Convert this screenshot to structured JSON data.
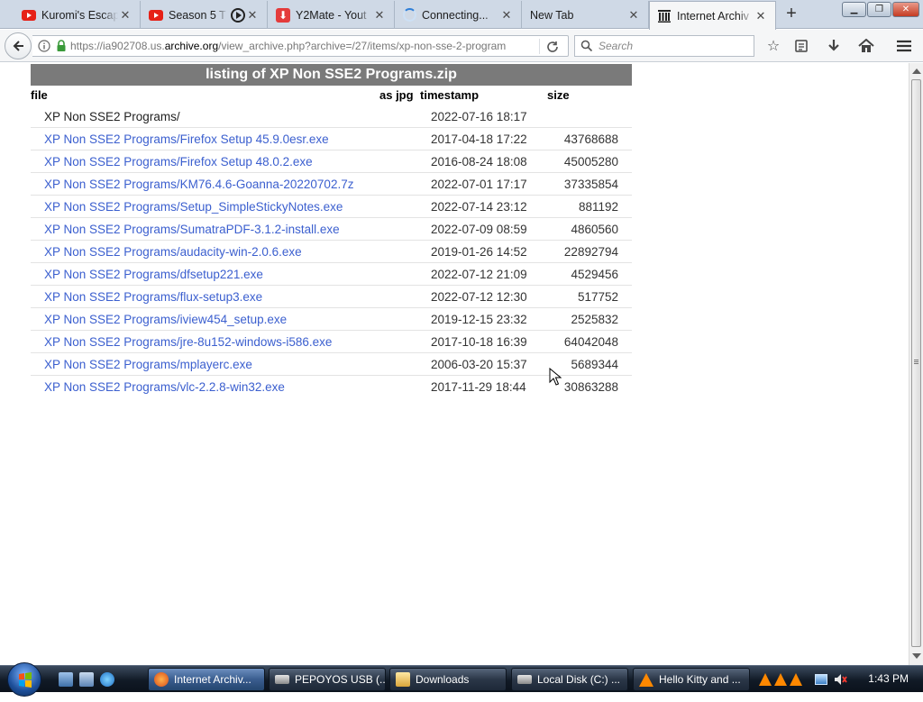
{
  "browser": {
    "tabs": [
      {
        "label": "Kuromi's Escap",
        "icon": "youtube-icon"
      },
      {
        "label": "Season 5 T",
        "icon": "youtube-icon"
      },
      {
        "label": "Y2Mate - Yout",
        "icon": "download-icon"
      },
      {
        "label": "Connecting...",
        "icon": "spinner-icon"
      },
      {
        "label": "New Tab",
        "icon": ""
      },
      {
        "label": "Internet Archiv",
        "icon": "archive-icon",
        "active": true
      }
    ],
    "url": {
      "prefix": "https://ia902708.us.",
      "domain": "archive.org",
      "suffix": "/view_archive.php?archive=/27/items/xp-non-sse-2-program"
    },
    "search_placeholder": "Search"
  },
  "listing": {
    "title": "listing of XP Non SSE2 Programs.zip",
    "headers": {
      "file": "file",
      "as_jpg": "as jpg",
      "timestamp": "timestamp",
      "size": "size"
    },
    "rows": [
      {
        "file": "XP Non SSE2 Programs/",
        "timestamp": "2022-07-16 18:17",
        "size": "",
        "is_dir": true
      },
      {
        "file": "XP Non SSE2 Programs/Firefox Setup 45.9.0esr.exe",
        "timestamp": "2017-04-18 17:22",
        "size": "43768688"
      },
      {
        "file": "XP Non SSE2 Programs/Firefox Setup 48.0.2.exe",
        "timestamp": "2016-08-24 18:08",
        "size": "45005280"
      },
      {
        "file": "XP Non SSE2 Programs/KM76.4.6-Goanna-20220702.7z",
        "timestamp": "2022-07-01 17:17",
        "size": "37335854"
      },
      {
        "file": "XP Non SSE2 Programs/Setup_SimpleStickyNotes.exe",
        "timestamp": "2022-07-14 23:12",
        "size": "881192"
      },
      {
        "file": "XP Non SSE2 Programs/SumatraPDF-3.1.2-install.exe",
        "timestamp": "2022-07-09 08:59",
        "size": "4860560"
      },
      {
        "file": "XP Non SSE2 Programs/audacity-win-2.0.6.exe",
        "timestamp": "2019-01-26 14:52",
        "size": "22892794"
      },
      {
        "file": "XP Non SSE2 Programs/dfsetup221.exe",
        "timestamp": "2022-07-12 21:09",
        "size": "4529456"
      },
      {
        "file": "XP Non SSE2 Programs/flux-setup3.exe",
        "timestamp": "2022-07-12 12:30",
        "size": "517752"
      },
      {
        "file": "XP Non SSE2 Programs/iview454_setup.exe",
        "timestamp": "2019-12-15 23:32",
        "size": "2525832"
      },
      {
        "file": "XP Non SSE2 Programs/jre-8u152-windows-i586.exe",
        "timestamp": "2017-10-18 16:39",
        "size": "64042048"
      },
      {
        "file": "XP Non SSE2 Programs/mplayerc.exe",
        "timestamp": "2006-03-20 15:37",
        "size": "5689344"
      },
      {
        "file": "XP Non SSE2 Programs/vlc-2.2.8-win32.exe",
        "timestamp": "2017-11-29 18:44",
        "size": "30863288"
      }
    ]
  },
  "taskbar": {
    "tasks": [
      {
        "label": "Internet Archiv...",
        "icon": "firefox-icon",
        "active": true
      },
      {
        "label": "PEPOYOS USB (...",
        "icon": "drive-icon"
      },
      {
        "label": "Downloads",
        "icon": "folder-icon"
      },
      {
        "label": "Local Disk (C:) ...",
        "icon": "drive-icon"
      },
      {
        "label": "Hello Kitty and ...",
        "icon": "vlc-icon"
      }
    ],
    "clock": "1:43 PM"
  },
  "colors": {
    "link": "#3b5fcf",
    "title_bar": "#7a7a7a",
    "tab_strip": "#cfd9e6"
  }
}
